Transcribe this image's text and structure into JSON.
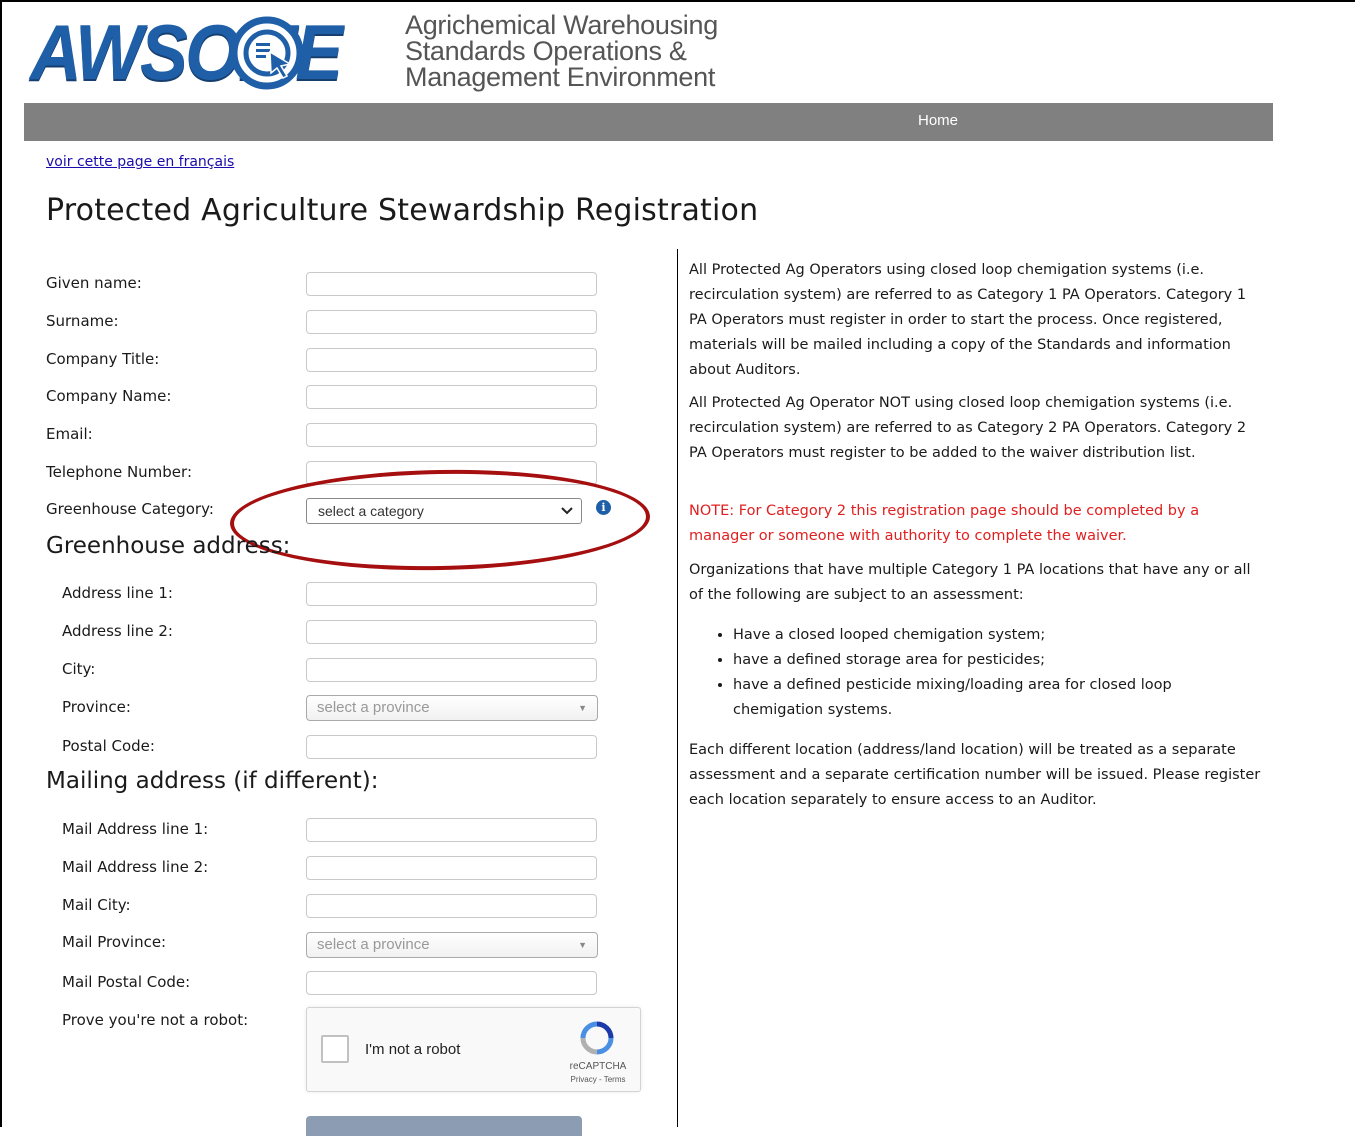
{
  "header": {
    "logo_word": "AWSOME",
    "tagline": [
      "Agrichemical Warehousing",
      "Standards Operations &",
      "Management Environment"
    ],
    "brand_color": "#1f5fa8"
  },
  "nav": {
    "home_label": "Home",
    "bar_color": "#808080"
  },
  "lang_link": "voir cette page en français",
  "page_title": "Protected Agriculture Stewardship Registration",
  "form": {
    "given_name_label": "Given name:",
    "surname_label": "Surname:",
    "company_title_label": "Company Title:",
    "company_name_label": "Company Name:",
    "email_label": "Email:",
    "telephone_label": "Telephone Number:",
    "category_label": "Greenhouse Category:",
    "category_selected": "select a category",
    "info_icon": "info-icon",
    "greenhouse_heading": "Greenhouse address:",
    "address1_label": "Address line 1:",
    "address2_label": "Address line 2:",
    "city_label": "City:",
    "province_label": "Province:",
    "province_selected": "select a province",
    "postal_label": "Postal Code:",
    "mailing_heading": "Mailing address (if different):",
    "mail_address1_label": "Mail Address line 1:",
    "mail_address2_label": "Mail Address line 2:",
    "mail_city_label": "Mail City:",
    "mail_province_label": "Mail Province:",
    "mail_province_selected": "select a province",
    "mail_postal_label": "Mail Postal Code:",
    "robot_label": "Prove you're not a robot:"
  },
  "recaptcha": {
    "checkbox_label": "I'm not a robot",
    "brand": "reCAPTCHA",
    "terms": "Privacy - Terms"
  },
  "info": {
    "para1": "All Protected Ag Operators using closed loop chemigation systems (i.e. recirculation system) are referred to as Category 1 PA Operators. Category 1 PA Operators must register in order to start the process. Once registered, materials will be mailed including a copy of the Standards and information about Auditors.",
    "para2": "All Protected Ag Operator NOT using closed loop chemigation systems (i.e. recirculation system) are referred to as Category 2 PA Operators. Category 2 PA Operators must register to be added to the waiver distribution list.",
    "note": "NOTE: For Category 2 this registration page should be completed by a manager or someone with authority to complete the waiver.",
    "para3": "Organizations that have multiple Category 1 PA locations that have any or all of the following are subject to an assessment:",
    "bullets": [
      "Have a closed looped chemigation system;",
      "have a defined storage area for pesticides;",
      "have a defined pesticide mixing/loading area for closed loop chemigation systems."
    ],
    "para4": "Each different location (address/land location) will be treated as a separate assessment and a separate certification number will be issued. Please register each location separately to ensure access to an Auditor.",
    "note_color": "#e02020"
  },
  "annotation": {
    "ring_color": "#a50f0f"
  }
}
